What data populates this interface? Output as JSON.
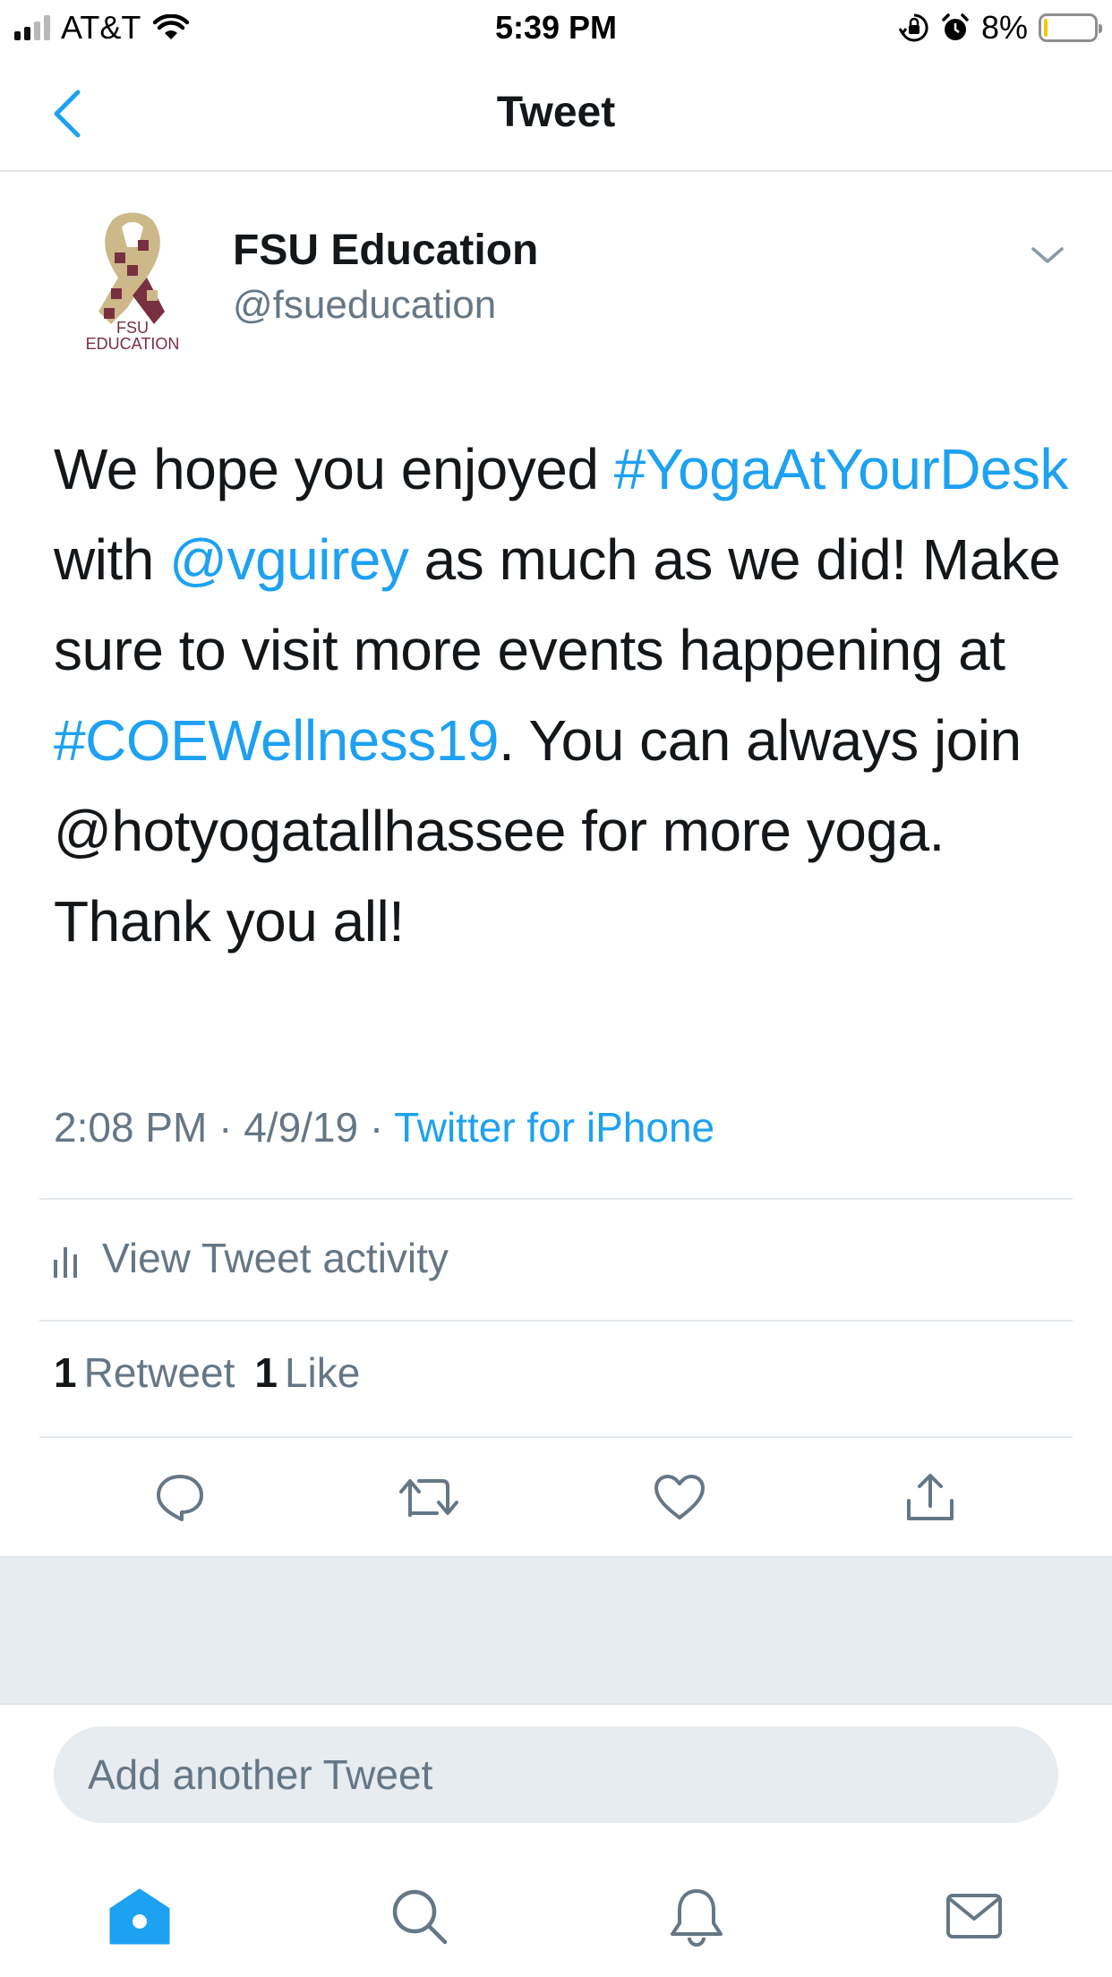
{
  "status_bar": {
    "carrier": "AT&T",
    "time": "5:39 PM",
    "battery_percent": "8%",
    "battery_level": 0.08,
    "battery_color": "#f7c600"
  },
  "nav": {
    "title": "Tweet",
    "back_icon": "chevron-left-icon"
  },
  "author": {
    "avatar_text_line1": "FSU",
    "avatar_text_line2": "EDUCATION",
    "display_name": "FSU Education",
    "handle": "@fsueducation"
  },
  "tweet": {
    "part1": "We hope you enjoyed ",
    "hashtag1": "#YogaAtYourDesk",
    "part2": " with ",
    "mention1": "@vguirey",
    "part3": " as much as we did! Make sure to visit more events happening at ",
    "hashtag2": "#COEWellness19",
    "part4": ". You can always join @hotyogatallhassee for more yoga. Thank you all!",
    "time": "2:08 PM",
    "separator": " · ",
    "date": "4/9/19",
    "source": "Twitter for iPhone"
  },
  "activity": {
    "label": "View Tweet activity",
    "icon": "analytics-bars-icon"
  },
  "counts": {
    "retweet_count": "1",
    "retweet_label": "Retweet",
    "like_count": "1",
    "like_label": "Like"
  },
  "actions": [
    "reply-icon",
    "retweet-icon",
    "like-icon",
    "share-icon"
  ],
  "reply": {
    "placeholder": "Add another Tweet"
  },
  "tab_bar": [
    "home-icon",
    "search-icon",
    "notifications-icon",
    "messages-icon"
  ],
  "colors": {
    "accent": "#1da1f2",
    "secondary_text": "#657786",
    "primary_text": "#14171a",
    "avatar_maroon": "#782f40",
    "avatar_gold": "#cdb88a"
  }
}
